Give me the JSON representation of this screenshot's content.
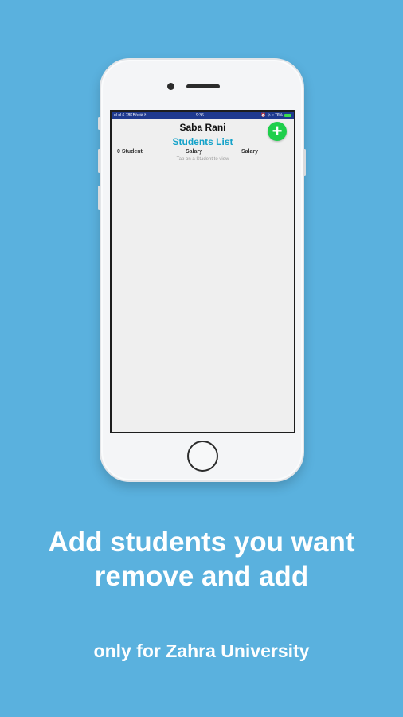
{
  "colors": {
    "background": "#5ab1de",
    "statusbar": "#1f3a8f",
    "title_accent": "#14a2c9",
    "add_button": "#1fcf4c"
  },
  "statusbar": {
    "left": "ııl ııl 6.78KB/s ✉ ↻",
    "time": "9:36",
    "right": "⏰ ⊙ ▿ 76%"
  },
  "app": {
    "user_name": "Saba Rani",
    "list_title": "Students List",
    "add_icon": "plus-icon",
    "columns": {
      "students": "0 Student",
      "salary_1": "Salary",
      "salary_2": "Salary"
    },
    "hint": "Tap on a Student to view"
  },
  "promo": {
    "headline_line1": "Add students you want",
    "headline_line2": "remove and add",
    "subline": "only for Zahra University"
  }
}
